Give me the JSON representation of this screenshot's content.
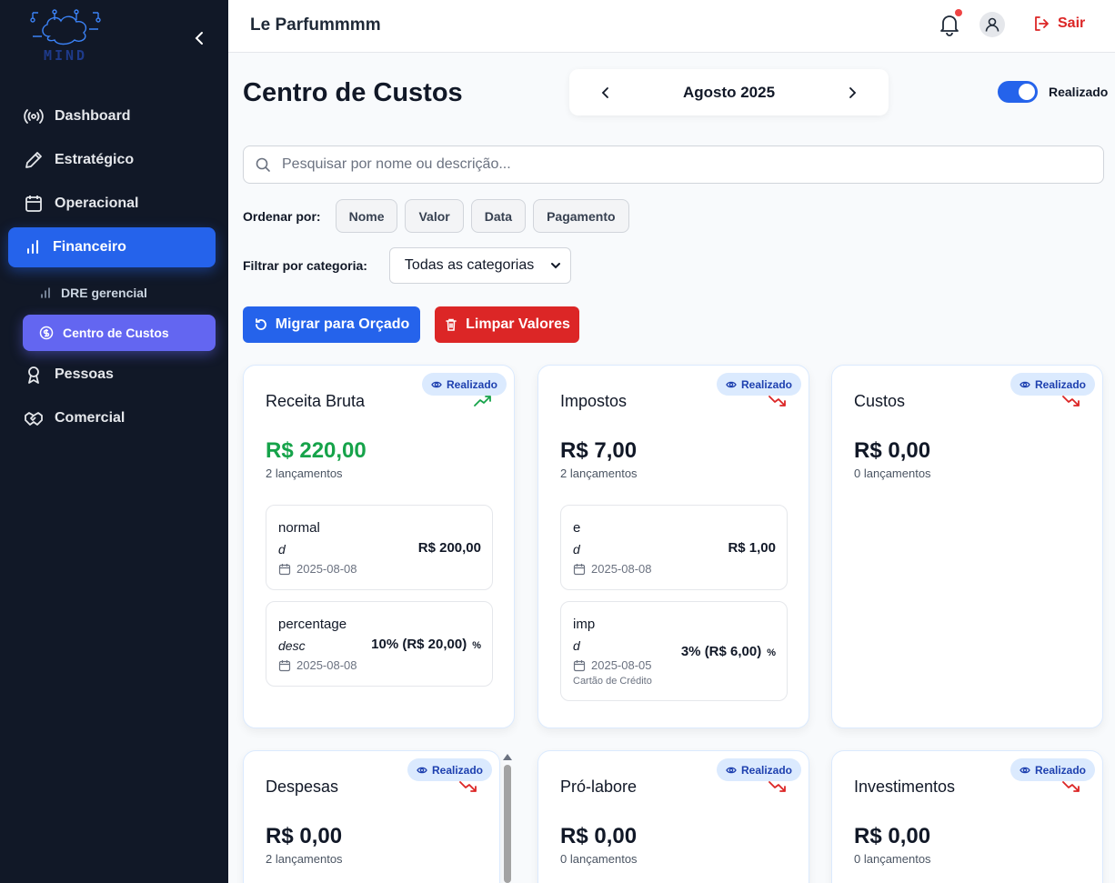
{
  "sidebar": {
    "logo_text": "MIND",
    "items": [
      {
        "label": "Dashboard",
        "icon": "broadcast-icon"
      },
      {
        "label": "Estratégico",
        "icon": "pencil-icon"
      },
      {
        "label": "Operacional",
        "icon": "calendar-icon"
      },
      {
        "label": "Financeiro",
        "icon": "bar-chart-icon",
        "active": true
      },
      {
        "label": "Pessoas",
        "icon": "award-icon"
      },
      {
        "label": "Comercial",
        "icon": "handshake-icon"
      }
    ],
    "sub_items": [
      {
        "label": "DRE gerencial",
        "icon": "bar-chart-icon"
      },
      {
        "label": "Centro de Custos",
        "icon": "dollar-circle-icon",
        "active": true
      }
    ]
  },
  "header": {
    "company": "Le Parfummmm",
    "logout_label": "Sair"
  },
  "page": {
    "title": "Centro de Custos",
    "month": "Agosto 2025",
    "toggle_label": "Realizado",
    "toggle_on": true
  },
  "search": {
    "placeholder": "Pesquisar por nome ou descrição...",
    "value": ""
  },
  "sort": {
    "label": "Ordenar por:",
    "options": [
      "Nome",
      "Valor",
      "Data",
      "Pagamento"
    ]
  },
  "filter": {
    "label": "Filtrar por categoria:",
    "selected": "Todas as categorias"
  },
  "actions": {
    "migrate_label": "Migrar para Orçado",
    "clear_label": "Limpar Valores"
  },
  "colors": {
    "primary": "#2563eb",
    "danger": "#dc2626",
    "success": "#16a34a",
    "sidebar_bg": "#111827",
    "sub_active": "#6366f1"
  },
  "cards": [
    {
      "title": "Receita Bruta",
      "badge": "Realizado",
      "trend": "up",
      "amount": "R$ 220,00",
      "count": "2 lançamentos",
      "entries": [
        {
          "name": "normal",
          "desc": "d",
          "date": "2025-08-08",
          "value": "R$ 200,00"
        },
        {
          "name": "percentage",
          "desc": "desc",
          "date": "2025-08-08",
          "value": "10% (R$ 20,00)",
          "pct": "%"
        }
      ]
    },
    {
      "title": "Impostos",
      "badge": "Realizado",
      "trend": "down",
      "amount": "R$ 7,00",
      "count": "2 lançamentos",
      "entries": [
        {
          "name": "e",
          "desc": "d",
          "date": "2025-08-08",
          "value": "R$ 1,00"
        },
        {
          "name": "imp",
          "desc": "d",
          "date": "2025-08-05",
          "value": "3% (R$ 6,00)",
          "pct": "%",
          "extra": "Cartão de Crédito"
        }
      ]
    },
    {
      "title": "Custos",
      "badge": "Realizado",
      "trend": "down",
      "amount": "R$ 0,00",
      "count": "0 lançamentos",
      "entries": []
    },
    {
      "title": "Despesas",
      "badge": "Realizado",
      "trend": "down",
      "amount": "R$ 0,00",
      "count": "2 lançamentos",
      "entries": []
    },
    {
      "title": "Pró-labore",
      "badge": "Realizado",
      "trend": "down",
      "amount": "R$ 0,00",
      "count": "0 lançamentos",
      "entries": []
    },
    {
      "title": "Investimentos",
      "badge": "Realizado",
      "trend": "down",
      "amount": "R$ 0,00",
      "count": "0 lançamentos",
      "entries": []
    }
  ]
}
